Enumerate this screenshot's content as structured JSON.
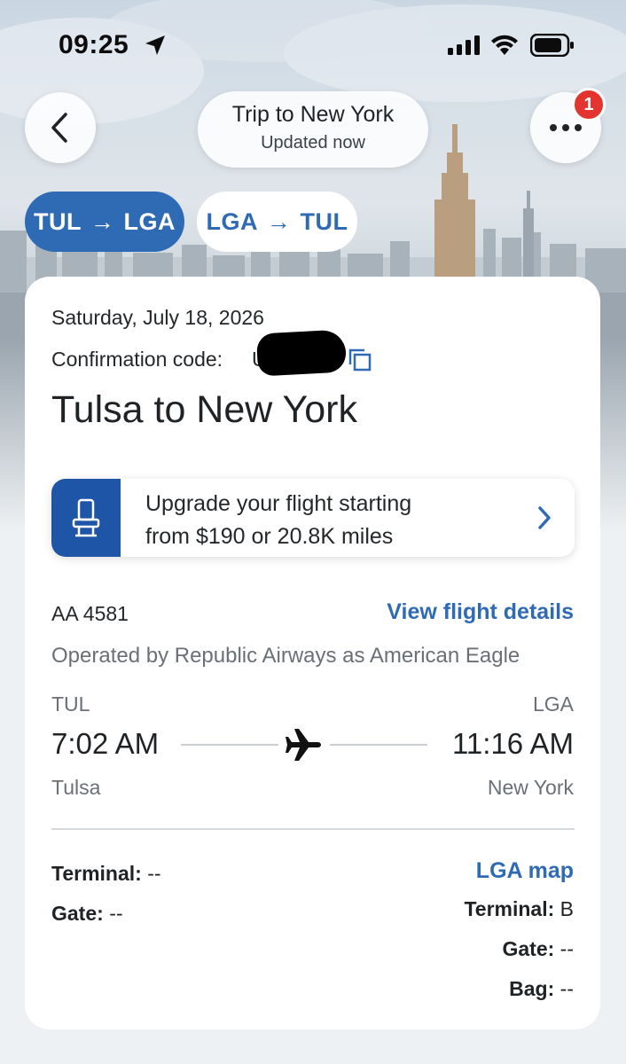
{
  "status_bar": {
    "time": "09:25"
  },
  "header": {
    "trip_title": "Trip to New York",
    "trip_subtitle": "Updated now",
    "notification_count": "1"
  },
  "segments": [
    {
      "from": "TUL",
      "to": "LGA",
      "active": true
    },
    {
      "from": "LGA",
      "to": "TUL",
      "active": false
    }
  ],
  "arrow_glyph": "→",
  "card": {
    "date": "Saturday, July 18, 2026",
    "confirmation_label": "Confirmation code:",
    "confirmation_lead": "U",
    "route_title": "Tulsa to New York",
    "upgrade_line1": "Upgrade your flight starting",
    "upgrade_line2": "from $190 or 20.8K miles",
    "flight_number": "AA 4581",
    "view_details": "View flight details",
    "operated_by": "Operated by Republic Airways as American Eagle",
    "departure": {
      "code": "TUL",
      "time": "7:02 AM",
      "city": "Tulsa"
    },
    "arrival": {
      "code": "LGA",
      "time": "11:16 AM",
      "city": "New York"
    },
    "dep_terminal_label": "Terminal:",
    "dep_terminal_value": "--",
    "dep_gate_label": "Gate:",
    "dep_gate_value": "--",
    "map_link": "LGA map",
    "arr_terminal_label": "Terminal:",
    "arr_terminal_value": "B",
    "arr_gate_label": "Gate:",
    "arr_gate_value": "--",
    "arr_bag_label": "Bag:",
    "arr_bag_value": "--"
  },
  "icons": {
    "back": "chevron-left-icon",
    "more": "ellipsis-icon",
    "copy": "copy-icon",
    "seat": "seat-icon",
    "plane": "airplane-icon"
  },
  "colors": {
    "brand_blue": "#2f6ab5",
    "upgrade_blue": "#1f55a7",
    "badge_red": "#e3342f"
  }
}
